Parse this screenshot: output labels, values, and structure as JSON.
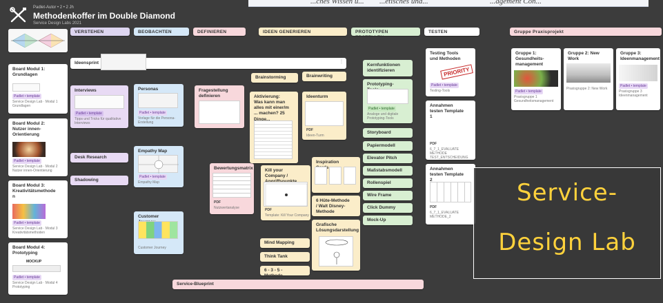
{
  "top_strip_text": [
    "...ches Wissen ü...",
    "...etisches und...",
    "...agement Con..."
  ],
  "header": {
    "meta": "Padlet-Autor • 2 • 2 Jh",
    "title": "Methodenkoffer im Double Diamond",
    "subtitle": "Service Design Labs 2021"
  },
  "columns": {
    "verstehen": "VERSTEHEN",
    "beobachten": "BEOBACHTEN",
    "definieren": "DEFINIEREN",
    "ideen": "IDEEN GENERIEREN",
    "prototypen": "PROTOTYPEN ERSTELLEN",
    "testen": "TESTEN",
    "gruppe": "Gruppe Praxisprojekt"
  },
  "sidebar": [
    {
      "label": "Board Modul 1: Grundlagen",
      "caption": "Service Design Lab · Modul 1 Grundlagen"
    },
    {
      "label": "Board Modul 2: Nutzer innen-Orientierung",
      "caption": "Service Design Lab · Modul 2 Nutzer innen-Orientierung"
    },
    {
      "label": "Board Modul 3: Kreativitätsmethode n",
      "caption": "Service Design Lab · Modul 3 Kreativitätsmethoden"
    },
    {
      "label": "Board Modul 4: Prototyping",
      "caption": "Service Design Lab · Modul 4 Prototyping",
      "thumb_title": "MOCKUP"
    }
  ],
  "cards": {
    "ideensprint": "Ideensprint",
    "interviews": "Interviews",
    "interviews_caption": "Tipps und Tricks für qualitative Interviews",
    "desk_research": "Desk Research",
    "shadowing": "Shadowing",
    "personas": "Personas",
    "personas_caption": "Vorlage für die Persona-Erstellung",
    "empathy_map": "Empathy Map",
    "empathy_caption": "Empathy Map",
    "customer_journey": "Customer Journey",
    "customer_caption": "Customer Journey",
    "fragestellung": "Fragestellung definieren",
    "bewertungsmatrix": "Bewertungsmatrix",
    "bewertung_caption": "Nutzwertanalyse",
    "brainstorming": "Brainstorming",
    "brainwriting": "Brainwriting",
    "aktivierung": "Aktivierung: Was kann man alles mit einer/m ... machen? 25 Dinge...",
    "ideenturm": "Ideenturm",
    "ideenturm_caption": "Ideen-Turm",
    "kill_company": "Kill your Company / Angriffspunkte",
    "kill_caption": "Template: Kill Your Company",
    "inspiration_cards": "Inspiration Cards",
    "sechs_huete": "6 Hüte-Methode / Walt Disney-Methode",
    "grafische": "Grafische Lösungsdarstellung",
    "mind_mapping": "Mind Mapping",
    "think_tank": "Think Tank",
    "sechs_drei_fuenf": "6 - 3 - 5 - Methode",
    "service_blueprint": "Service-Blueprint",
    "kernfunktionen": "Kernfunktionen identifizieren",
    "prototyping_tools": "Prototyping-Tools",
    "prototyping_caption": "Analoge und digitale Prototyping-Tools",
    "storyboard": "Storyboard",
    "papiermodell": "Papiermodell",
    "elevator_pitch": "Elevator Pitch",
    "massstabsmodell": "Maßstabsmodell",
    "rollenspiel": "Rollenspiel",
    "wire_frame": "Wire Frame",
    "click_dummy": "Click Dummy",
    "mock_up": "Mock-Up",
    "testing_tools": "Testing Tools und Methoden",
    "testing_caption": "Testing-Tools",
    "priority_stamp": "PRIORITY",
    "annahmen1": "Annahmen testen Template 1",
    "annahmen1_caption": "6_7_1_EVALUATE METHODE TEST_ENTSCHEIDUNG",
    "annahmen2": "Annahmen testen Template 2",
    "annahmen2_caption": "6_7_1_EVALUATE METHODE_2",
    "gruppe1": "Gruppe 1: Gesundheits-management",
    "gruppe1_caption": "Praxisgruppe 1 Gesundheitsmanagement",
    "gruppe2": "Gruppe 2: New Work",
    "gruppe2_caption": "Praxisgruppe 2: New Work",
    "gruppe3": "Gruppe 3: Ideenmanagement",
    "gruppe3_caption": "Praxisgruppe 3 Ideenmanagement"
  },
  "tag_label": "Padlet • template",
  "pdf_label": "PDF",
  "logo": {
    "line1": "Service-",
    "line2": "Design Lab"
  }
}
